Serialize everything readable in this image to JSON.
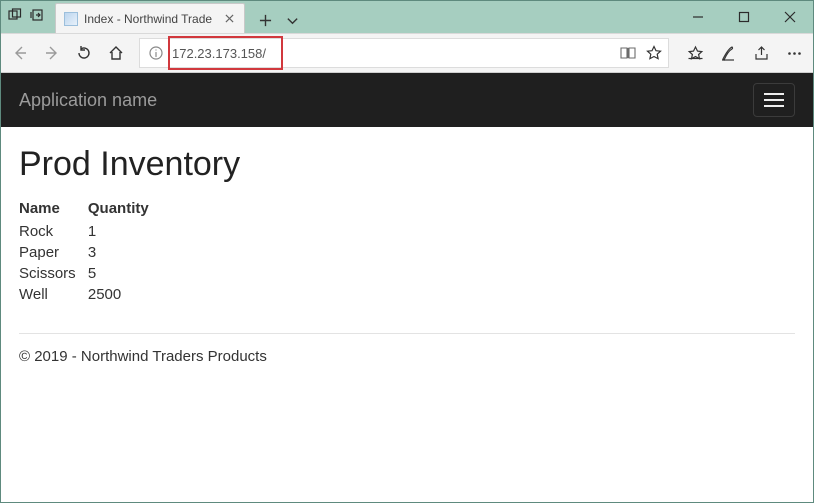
{
  "browser": {
    "tab_title": "Index - Northwind Trade",
    "url": "172.23.173.158/"
  },
  "app": {
    "brand": "Application name"
  },
  "page": {
    "heading": "Prod Inventory",
    "columns": {
      "name": "Name",
      "quantity": "Quantity"
    },
    "rows": [
      {
        "name": "Rock",
        "qty": "1"
      },
      {
        "name": "Paper",
        "qty": "3"
      },
      {
        "name": "Scissors",
        "qty": "5"
      },
      {
        "name": "Well",
        "qty": "2500"
      }
    ],
    "footer": "© 2019 - Northwind Traders Products"
  }
}
